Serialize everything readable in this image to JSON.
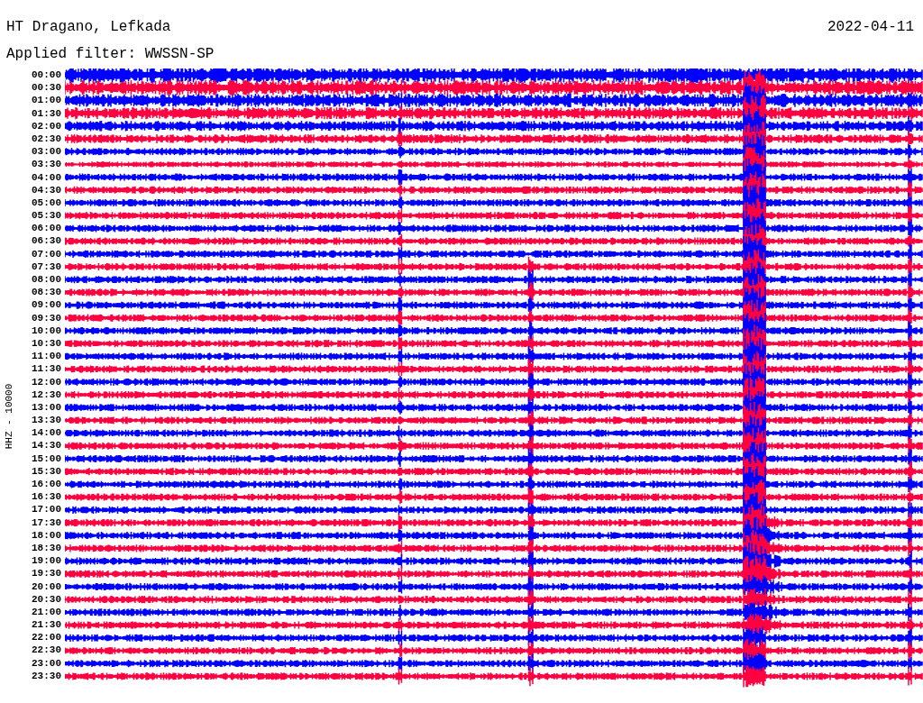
{
  "header": {
    "station": "HT Dragano, Lefkada",
    "date": "2022-04-11",
    "filter": "Applied filter: WWSSN-SP"
  },
  "axis_label": "HHZ - 10000",
  "rows": [
    {
      "time": "00:00",
      "color": "#0000ff"
    },
    {
      "time": "00:30",
      "color": "#ff0040"
    },
    {
      "time": "01:00",
      "color": "#0000ff"
    },
    {
      "time": "01:30",
      "color": "#ff0040"
    },
    {
      "time": "02:00",
      "color": "#0000ff"
    },
    {
      "time": "02:30",
      "color": "#ff0040"
    },
    {
      "time": "03:00",
      "color": "#0000ff"
    },
    {
      "time": "03:30",
      "color": "#ff0040"
    },
    {
      "time": "04:00",
      "color": "#0000ff"
    },
    {
      "time": "04:30",
      "color": "#ff0040"
    },
    {
      "time": "05:00",
      "color": "#0000ff"
    },
    {
      "time": "05:30",
      "color": "#ff0040"
    },
    {
      "time": "06:00",
      "color": "#0000ff"
    },
    {
      "time": "06:30",
      "color": "#ff0040"
    },
    {
      "time": "07:00",
      "color": "#0000ff"
    },
    {
      "time": "07:30",
      "color": "#ff0040"
    },
    {
      "time": "08:00",
      "color": "#0000ff"
    },
    {
      "time": "08:30",
      "color": "#ff0040"
    },
    {
      "time": "09:00",
      "color": "#0000ff"
    },
    {
      "time": "09:30",
      "color": "#ff0040"
    },
    {
      "time": "10:00",
      "color": "#0000ff"
    },
    {
      "time": "10:30",
      "color": "#ff0040"
    },
    {
      "time": "11:00",
      "color": "#0000ff"
    },
    {
      "time": "11:30",
      "color": "#ff0040"
    },
    {
      "time": "12:00",
      "color": "#0000ff"
    },
    {
      "time": "12:30",
      "color": "#ff0040"
    },
    {
      "time": "13:00",
      "color": "#0000ff"
    },
    {
      "time": "13:30",
      "color": "#ff0040"
    },
    {
      "time": "14:00",
      "color": "#0000ff"
    },
    {
      "time": "14:30",
      "color": "#ff0040"
    },
    {
      "time": "15:00",
      "color": "#0000ff"
    },
    {
      "time": "15:30",
      "color": "#ff0040"
    },
    {
      "time": "16:00",
      "color": "#0000ff"
    },
    {
      "time": "16:30",
      "color": "#ff0040"
    },
    {
      "time": "17:00",
      "color": "#0000ff"
    },
    {
      "time": "17:30",
      "color": "#ff0040"
    },
    {
      "time": "18:00",
      "color": "#0000ff"
    },
    {
      "time": "18:30",
      "color": "#ff0040"
    },
    {
      "time": "19:00",
      "color": "#0000ff"
    },
    {
      "time": "19:30",
      "color": "#ff0040"
    },
    {
      "time": "20:00",
      "color": "#0000ff"
    },
    {
      "time": "20:30",
      "color": "#ff0040"
    },
    {
      "time": "21:00",
      "color": "#0000ff"
    },
    {
      "time": "21:30",
      "color": "#ff0040"
    },
    {
      "time": "22:00",
      "color": "#0000ff"
    },
    {
      "time": "22:30",
      "color": "#ff0040"
    },
    {
      "time": "23:00",
      "color": "#0000ff"
    },
    {
      "time": "23:30",
      "color": "#ff0040"
    }
  ]
}
